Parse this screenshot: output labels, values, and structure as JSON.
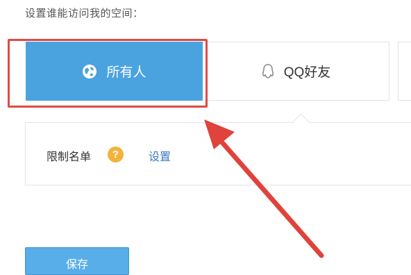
{
  "header": {
    "prompt": "设置谁能访问我的空间："
  },
  "options": [
    {
      "label": "所有人",
      "icon": "globe-icon",
      "selected": true
    },
    {
      "label": "QQ好友",
      "icon": "qq-penguin-icon",
      "selected": false
    }
  ],
  "restriction": {
    "label": "限制名单",
    "help_icon": "?",
    "settings_label": "设置"
  },
  "footer": {
    "save_label": "保存"
  },
  "colors": {
    "selected_bg": "#4aa3df",
    "highlight": "#e04a45",
    "help_icon": "#f2b33d",
    "link": "#3c78c0",
    "button": "#58aee8"
  }
}
